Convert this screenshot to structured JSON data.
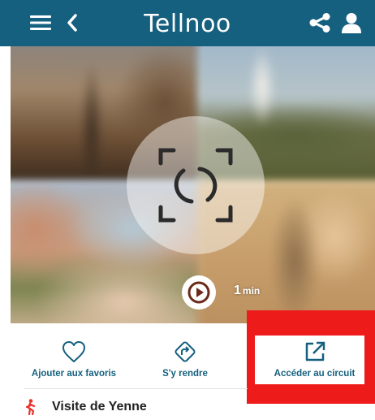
{
  "header": {
    "brand": "Tellnoo",
    "background_color": "#15607e",
    "icons": [
      "menu-icon",
      "back-arrow-icon",
      "share-icon",
      "user-icon"
    ]
  },
  "hero": {
    "duration_value": "1",
    "duration_unit": "min",
    "icons": [
      "camera-scan-icon",
      "play-icon"
    ]
  },
  "actions": {
    "favorites_label": "Ajouter aux favoris",
    "route_label": "S'y rendre",
    "access_label": "Accéder au circuit"
  },
  "tour": {
    "title": "Visite de Yenne"
  },
  "colors": {
    "accent": "#15607e",
    "highlight": "#ee1b1b",
    "walk_icon": "#e5332a"
  }
}
